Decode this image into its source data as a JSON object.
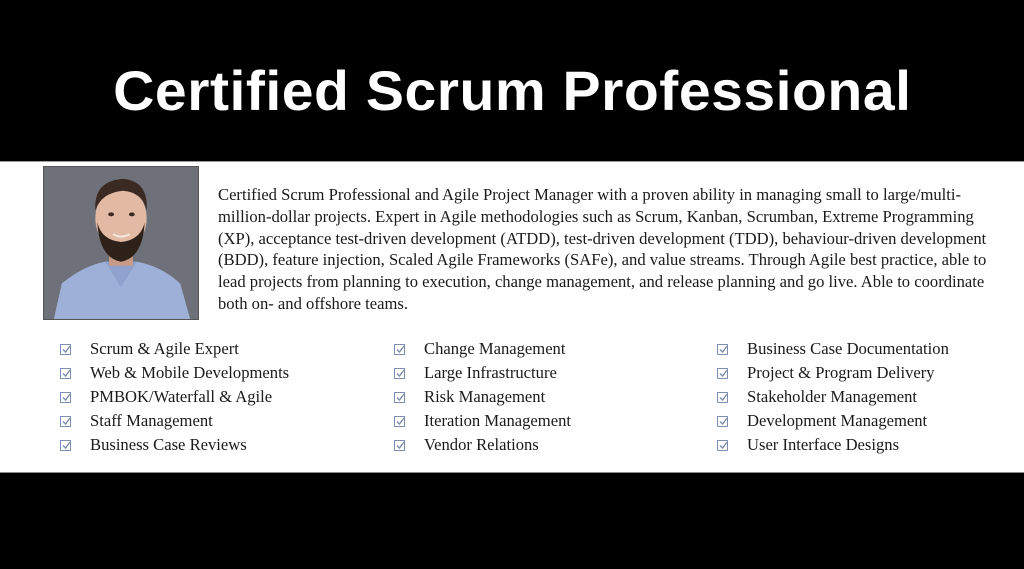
{
  "header": {
    "title": "Certified Scrum Professional"
  },
  "profile": {
    "photo_alt": "Portrait of a bearded man in a light blue shirt",
    "summary": "Certified Scrum Professional and Agile Project Manager with a proven ability in managing small to large/multi-million-dollar projects. Expert in Agile methodologies such as Scrum, Kanban, Scrumban, Extreme Programming (XP), acceptance test-driven development (ATDD), test-driven development (TDD), behaviour-driven development (BDD), feature injection, Scaled Agile Frameworks (SAFe), and value streams. Through Agile best practice, able to lead projects from planning to execution, change management, and release planning and go live. Able to coordinate both on- and offshore teams."
  },
  "skills": {
    "icon": "checkbox-checked-icon",
    "check_color": "#7d8fb0",
    "columns": [
      [
        "Scrum & Agile Expert",
        "Web & Mobile Developments",
        "PMBOK/Waterfall & Agile",
        "Staff Management",
        "Business Case Reviews"
      ],
      [
        "Change Management",
        "Large Infrastructure",
        "Risk Management",
        "Iteration Management",
        "Vendor Relations"
      ],
      [
        "Business Case Documentation",
        "Project & Program Delivery",
        "Stakeholder Management",
        "Development Management",
        "User Interface Designs"
      ]
    ]
  }
}
